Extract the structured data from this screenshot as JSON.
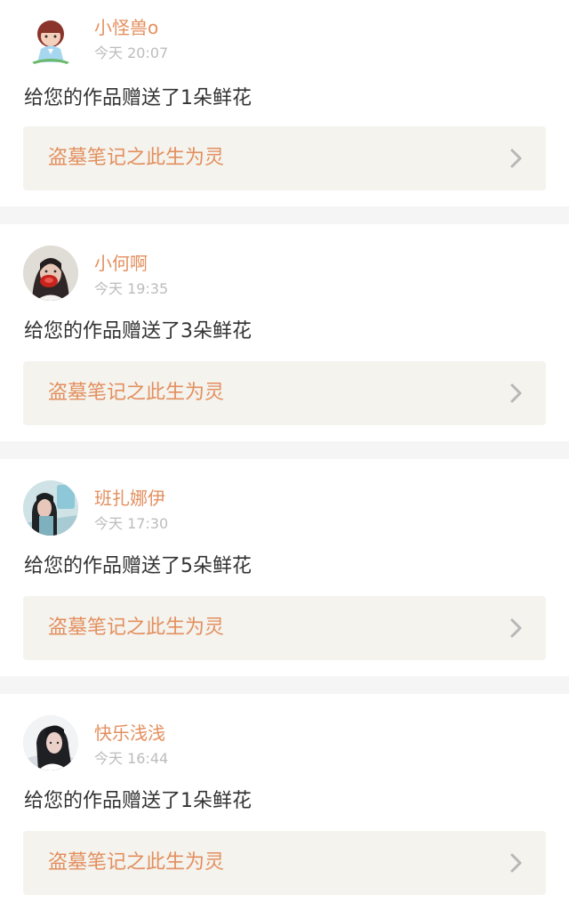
{
  "notifications": [
    {
      "username": "小怪兽o",
      "timestamp": "今天 20:07",
      "message": "给您的作品赠送了1朵鲜花",
      "work_title": "盗墓笔记之此生为灵"
    },
    {
      "username": "小何啊",
      "timestamp": "今天 19:35",
      "message": "给您的作品赠送了3朵鲜花",
      "work_title": "盗墓笔记之此生为灵"
    },
    {
      "username": "班扎娜伊",
      "timestamp": "今天 17:30",
      "message": "给您的作品赠送了5朵鲜花",
      "work_title": "盗墓笔记之此生为灵"
    },
    {
      "username": "快乐浅浅",
      "timestamp": "今天 16:44",
      "message": "给您的作品赠送了1朵鲜花",
      "work_title": "盗墓笔记之此生为灵"
    }
  ],
  "colors": {
    "username": "#e38f5e",
    "timestamp": "#bcbcbc",
    "message": "#333333",
    "work_link_background": "#f4f3ee",
    "separator": "#f5f5f5"
  },
  "icons": {
    "chevron": "chevron-right-icon"
  }
}
